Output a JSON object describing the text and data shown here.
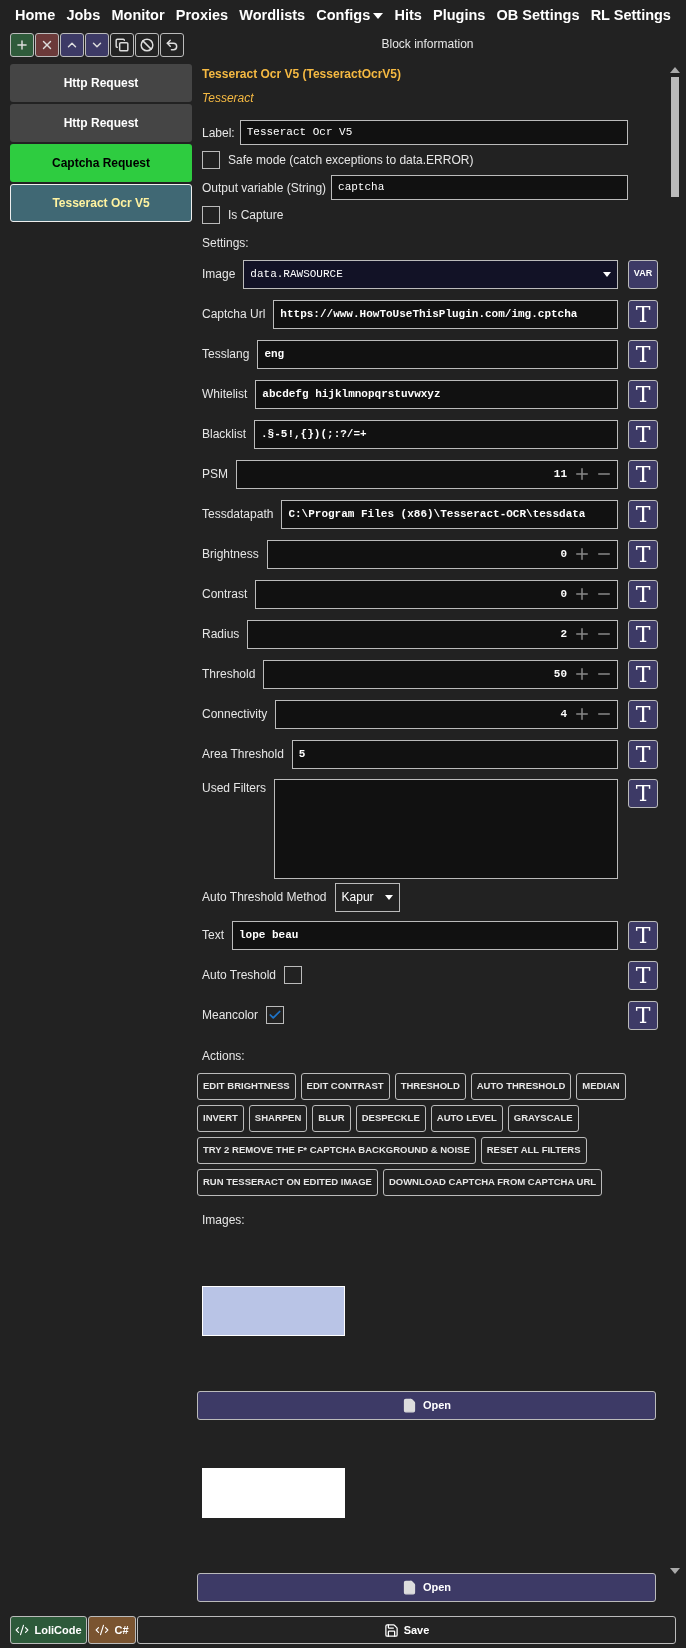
{
  "nav": [
    {
      "label": "Home",
      "has_menu": false
    },
    {
      "label": "Jobs",
      "has_menu": false
    },
    {
      "label": "Monitor",
      "has_menu": false
    },
    {
      "label": "Proxies",
      "has_menu": false
    },
    {
      "label": "Wordlists",
      "has_menu": false
    },
    {
      "label": "Configs",
      "has_menu": true
    },
    {
      "label": "Hits",
      "has_menu": false
    },
    {
      "label": "Plugins",
      "has_menu": false
    },
    {
      "label": "OB Settings",
      "has_menu": false
    },
    {
      "label": "RL Settings",
      "has_menu": false
    }
  ],
  "toolbar": [
    {
      "kind": "add"
    },
    {
      "kind": "remove"
    },
    {
      "kind": "up"
    },
    {
      "kind": "down"
    },
    {
      "kind": "clone"
    },
    {
      "kind": "disable"
    },
    {
      "kind": "undo"
    }
  ],
  "blocks": [
    {
      "label": "Http Request",
      "kind": "http",
      "selected": false
    },
    {
      "label": "Http Request",
      "kind": "http",
      "selected": false
    },
    {
      "label": "Captcha Request",
      "kind": "captcha",
      "selected": false
    },
    {
      "label": "Tesseract Ocr V5",
      "kind": "plugin",
      "selected": true
    }
  ],
  "block_info": {
    "header": "Block information",
    "title": "Tesseract Ocr V5 (TesseractOcrV5)",
    "subtitle": "Tesseract",
    "label": {
      "label": "Label:",
      "value": "Tesseract Ocr V5"
    },
    "safe_mode": {
      "label": "Safe mode (catch exceptions to data.ERROR)",
      "checked": false
    },
    "output_variable": {
      "label": "Output variable (String)",
      "value": "captcha"
    },
    "is_capture": {
      "label": "Is Capture",
      "checked": false
    },
    "settings_heading": "Settings:",
    "settings": [
      {
        "kind": "select",
        "label": "Image",
        "value": "data.RAWSOURCE",
        "side_button": "VAR"
      },
      {
        "kind": "text",
        "label": "Captcha Url",
        "value": "https://www.HowToUseThisPlugin.com/img.cptcha",
        "side_button": "T"
      },
      {
        "kind": "text",
        "label": "Tesslang",
        "value": "eng",
        "side_button": "T"
      },
      {
        "kind": "text",
        "label": "Whitelist",
        "value": "abcdefg hijklmnopqrstuvwxyz",
        "side_button": "T"
      },
      {
        "kind": "text",
        "label": "Blacklist",
        "value": ".§-5!,{})(;:?/=+",
        "side_button": "T"
      },
      {
        "kind": "number",
        "label": "PSM",
        "value": "11",
        "side_button": "T"
      },
      {
        "kind": "text",
        "label": "Tessdatapath",
        "value": "C:\\Program Files (x86)\\Tesseract-OCR\\tessdata",
        "side_button": "T"
      },
      {
        "kind": "number",
        "label": "Brightness",
        "value": "0",
        "side_button": "T"
      },
      {
        "kind": "number",
        "label": "Contrast",
        "value": "0",
        "side_button": "T"
      },
      {
        "kind": "number",
        "label": "Radius",
        "value": "2",
        "side_button": "T"
      },
      {
        "kind": "number",
        "label": "Threshold",
        "value": "50",
        "side_button": "T"
      },
      {
        "kind": "number",
        "label": "Connectivity",
        "value": "4",
        "side_button": "T"
      },
      {
        "kind": "text",
        "label": "Area Threshold",
        "value": "5",
        "side_button": "T"
      },
      {
        "kind": "textarea",
        "label": "Used Filters",
        "side_button": "T"
      },
      {
        "kind": "dropdown",
        "label": "Auto Threshold Method",
        "value": "Kapur"
      },
      {
        "kind": "text",
        "label": "Text",
        "value": "lope beau",
        "side_button": "T"
      },
      {
        "kind": "checkbox",
        "label": "Auto Treshold",
        "checked": false,
        "side_button": "T"
      },
      {
        "kind": "checkbox",
        "label": "Meancolor",
        "checked": true,
        "side_button": "T"
      }
    ],
    "actions_heading": "Actions:",
    "action_rows": [
      [
        "EDIT BRIGHTNESS",
        "EDIT CONTRAST",
        "THRESHOLD",
        "AUTO THRESHOLD",
        "MEDIAN"
      ],
      [
        "INVERT",
        "SHARPEN",
        "BLUR",
        "DESPECKLE",
        "AUTO LEVEL",
        "GRAYSCALE"
      ],
      [
        "TRY 2 REMOVE THE F* CAPTCHA BACKGROUND & NOISE",
        "RESET ALL FILTERS"
      ],
      [
        "RUN TESSERACT ON EDITED IMAGE",
        "DOWNLOAD CAPTCHA FROM CAPTCHA URL"
      ]
    ],
    "images_heading": "Images:",
    "images": [
      {
        "kind": "original",
        "button": "Open"
      },
      {
        "kind": "processed",
        "button": "Open"
      }
    ]
  },
  "bottom_bar": [
    {
      "kind": "loli",
      "label": "LoliCode"
    },
    {
      "kind": "csharp",
      "label": "C#"
    },
    {
      "kind": "save",
      "label": "Save"
    }
  ]
}
